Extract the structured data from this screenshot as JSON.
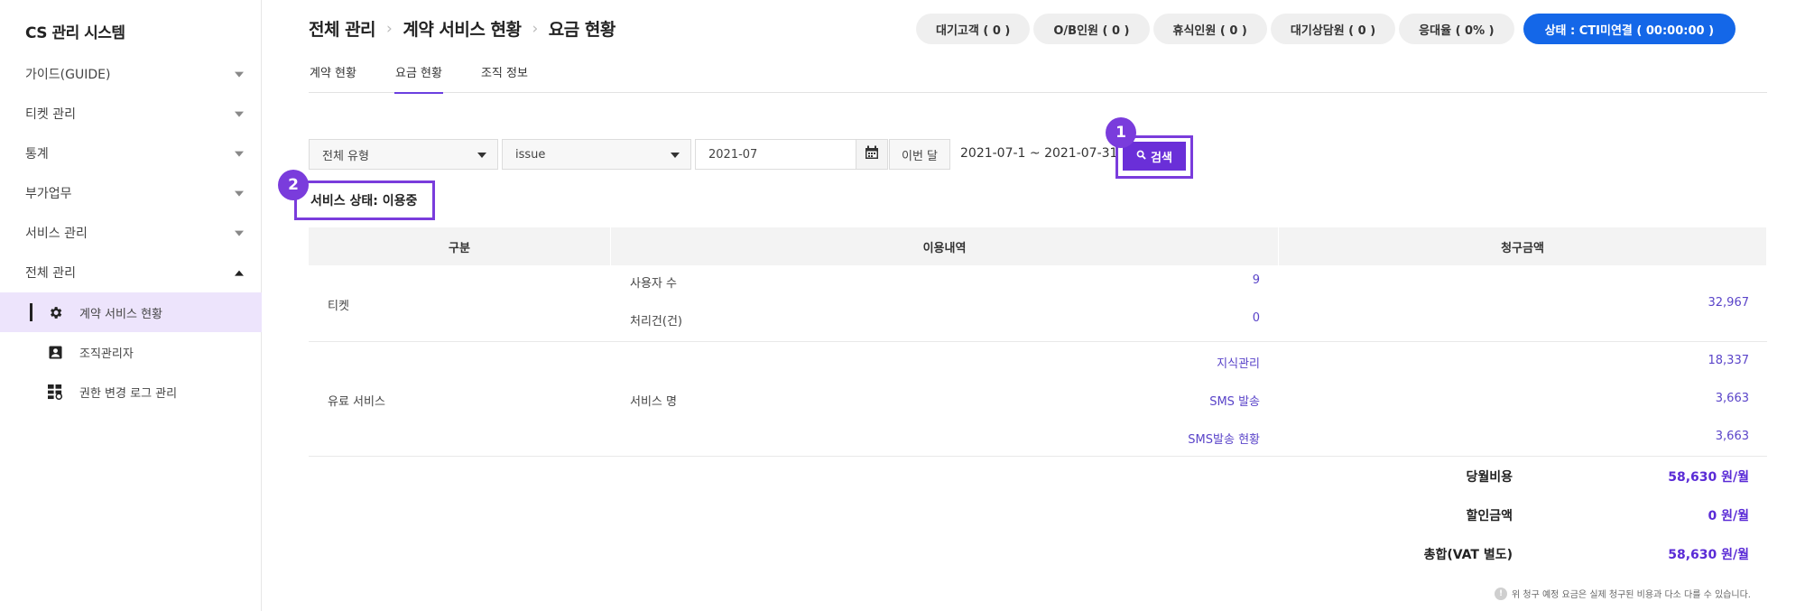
{
  "app": {
    "title": "CS 관리 시스템"
  },
  "sidebar": {
    "items": [
      {
        "label": "가이드(GUIDE)"
      },
      {
        "label": "티켓 관리"
      },
      {
        "label": "통계"
      },
      {
        "label": "부가업무"
      },
      {
        "label": "서비스 관리"
      },
      {
        "label": "전체 관리"
      }
    ],
    "subitems": [
      {
        "label": "계약 서비스 현황",
        "icon": "gear-icon"
      },
      {
        "label": "조직관리자",
        "icon": "person-card-icon"
      },
      {
        "label": "권한 변경 로그 관리",
        "icon": "grid-log-icon"
      }
    ]
  },
  "breadcrumb": [
    "전체 관리",
    "계약 서비스 현황",
    "요금 현황"
  ],
  "status": {
    "pills": [
      "대기고객 ( 0 )",
      "O/B인원 ( 0 )",
      "휴식인원 ( 0 )",
      "대기상담원 ( 0 )",
      "응대율 ( 0% )"
    ],
    "cti": "상태 : CTI미연결 ( 00:00:00 )",
    "cti_color": "#1467e8"
  },
  "tabs": [
    "계약 현황",
    "요금 현황",
    "조직 정보"
  ],
  "filters": {
    "type_select": "전체 유형",
    "issue_select": "issue",
    "month": "2021-07",
    "this_month_button": "이번 달",
    "date_range": "2021-07-1 ~ 2021-07-31",
    "search_button": "검색"
  },
  "annotations": {
    "badge1": "1",
    "badge2": "2",
    "accent": "#7a3cdc"
  },
  "service_status": "서비스 상태: 이용중",
  "table": {
    "headers": [
      "구분",
      "이용내역",
      "청구금액"
    ],
    "ticket": {
      "category": "티켓",
      "rows": [
        {
          "label": "사용자 수",
          "value": "9"
        },
        {
          "label": "처리건(건)",
          "value": "0"
        }
      ],
      "amount": "32,967"
    },
    "paid": {
      "category": "유료 서비스",
      "label": "서비스 명",
      "rows": [
        {
          "name": "지식관리",
          "amount": "18,337"
        },
        {
          "name": "SMS 발송",
          "amount": "3,663"
        },
        {
          "name": "SMS발송 현황",
          "amount": "3,663"
        }
      ]
    },
    "summary": [
      {
        "label": "당월비용",
        "value": "58,630 원/월"
      },
      {
        "label": "할인금액",
        "value": "0 원/월"
      },
      {
        "label": "총합(VAT 별도)",
        "value": "58,630 원/월"
      }
    ],
    "note": "위 청구 예정 요금은 실제 청구된 비용과 다소 다를 수 있습니다."
  }
}
